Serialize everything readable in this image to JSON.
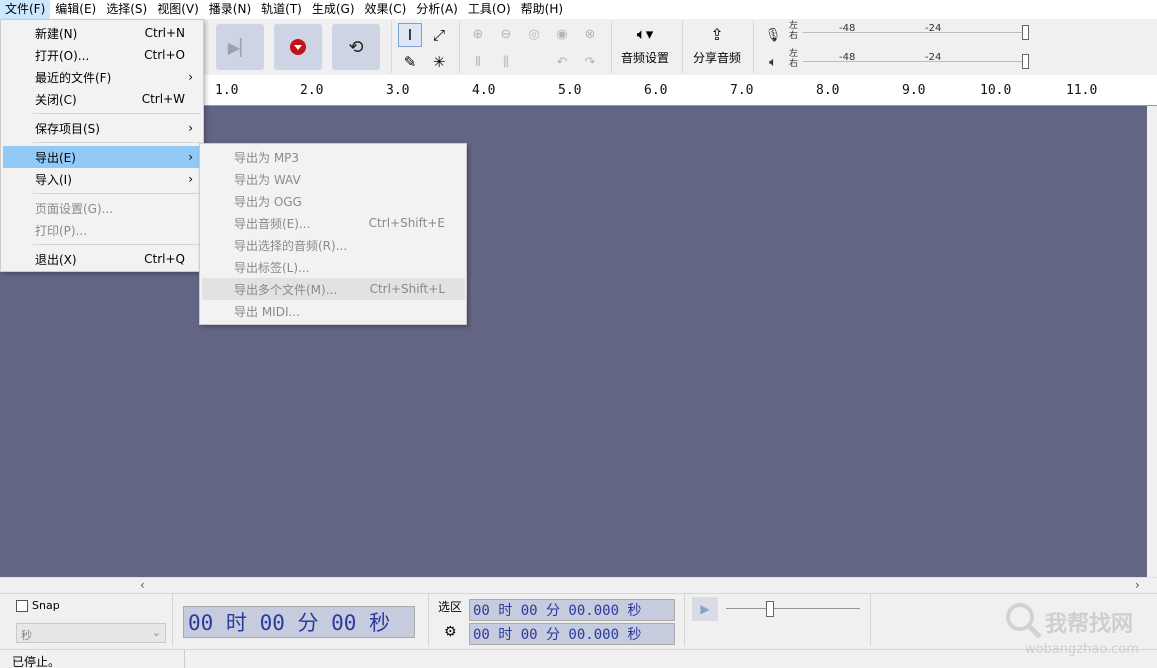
{
  "menubar": {
    "items": [
      "文件(F)",
      "编辑(E)",
      "选择(S)",
      "视图(V)",
      "播录(N)",
      "轨道(T)",
      "生成(G)",
      "效果(C)",
      "分析(A)",
      "工具(O)",
      "帮助(H)"
    ]
  },
  "file_menu": {
    "new": {
      "label": "新建(N)",
      "shortcut": "Ctrl+N"
    },
    "open": {
      "label": "打开(O)...",
      "shortcut": "Ctrl+O"
    },
    "recent": {
      "label": "最近的文件(F)"
    },
    "close": {
      "label": "关闭(C)",
      "shortcut": "Ctrl+W"
    },
    "save_project": {
      "label": "保存项目(S)"
    },
    "export": {
      "label": "导出(E)"
    },
    "import": {
      "label": "导入(I)"
    },
    "page_setup": {
      "label": "页面设置(G)..."
    },
    "print": {
      "label": "打印(P)..."
    },
    "exit": {
      "label": "退出(X)",
      "shortcut": "Ctrl+Q"
    }
  },
  "export_submenu": {
    "mp3": {
      "label": "导出为 MP3"
    },
    "wav": {
      "label": "导出为 WAV"
    },
    "ogg": {
      "label": "导出为 OGG"
    },
    "audio": {
      "label": "导出音频(E)...",
      "shortcut": "Ctrl+Shift+E"
    },
    "selected": {
      "label": "导出选择的音频(R)..."
    },
    "labels": {
      "label": "导出标签(L)..."
    },
    "multiple": {
      "label": "导出多个文件(M)...",
      "shortcut": "Ctrl+Shift+L"
    },
    "midi": {
      "label": "导出 MIDI..."
    }
  },
  "toolbar": {
    "audio_setup_label": "音频设置",
    "share_audio_label": "分享音频",
    "meter_ticks": [
      "-48",
      "-24"
    ],
    "channel_left": "左",
    "channel_right": "右"
  },
  "ruler": {
    "ticks": [
      "1.0",
      "2.0",
      "3.0",
      "4.0",
      "5.0",
      "6.0",
      "7.0",
      "8.0",
      "9.0",
      "10.0",
      "11.0"
    ]
  },
  "selection_bar": {
    "snap_label": "Snap",
    "snap_unit": "秒",
    "time_main": "00 时 00 分 00 秒",
    "selection_label": "选区",
    "sel_start": "00 时 00 分 00.000 秒",
    "sel_end": "00 时 00 分 00.000 秒"
  },
  "status": {
    "text": "已停止。"
  },
  "watermark": {
    "brand": "我帮找网",
    "url": "wobangzhao.com"
  },
  "colors": {
    "track_bg": "#636584",
    "menu_hover": "#91c9f7",
    "menubar_active": "#cce8ff",
    "time_text": "#2a3b9e"
  }
}
